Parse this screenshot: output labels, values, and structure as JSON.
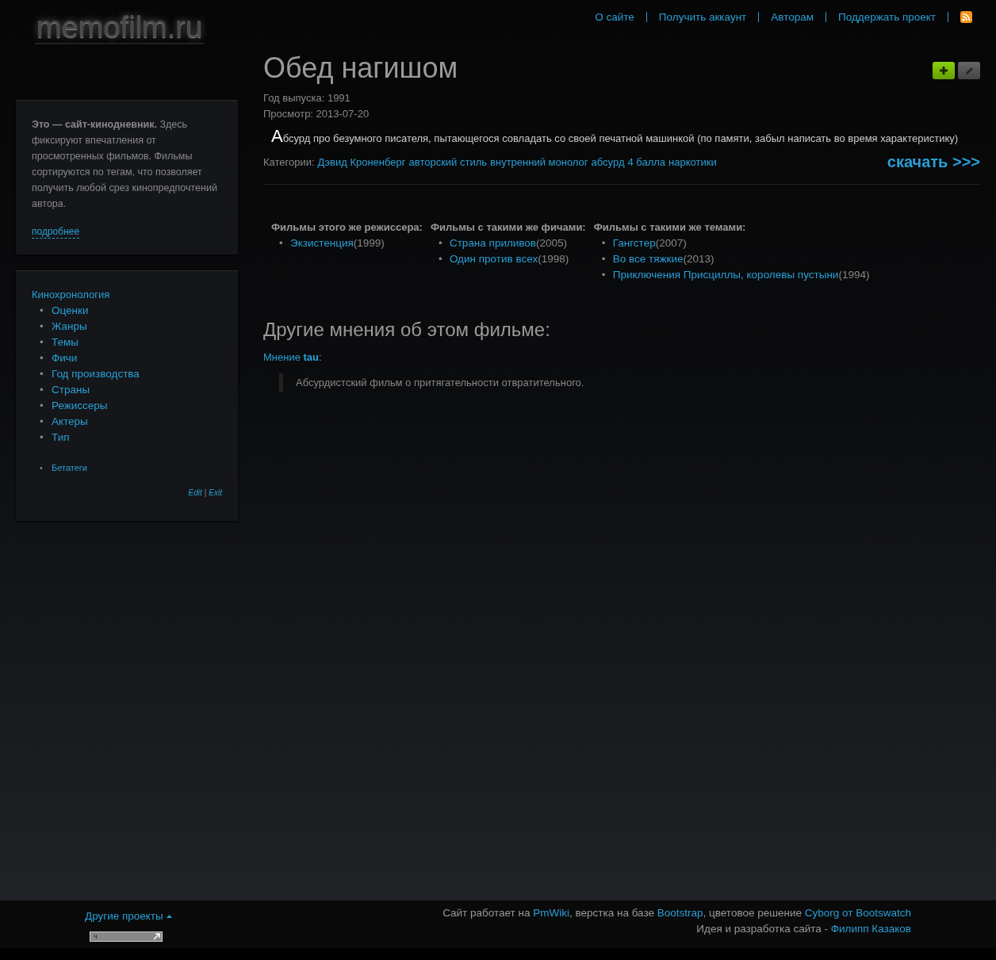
{
  "logo": "memofilm.ru",
  "top_nav": [
    {
      "label": "О сайте"
    },
    {
      "label": "Получить аккаунт"
    },
    {
      "label": "Авторам"
    },
    {
      "label": "Поддержать проект"
    }
  ],
  "about_box": {
    "text": "**Это — сайт-кинодневник.** Здесь фиксируют впечатления от просмотренных фильмов. Фильмы сортируются по тегам, что позволяет получить любой срез кинопредпочтений автора.",
    "more_link": "подробнее"
  },
  "nav_box": {
    "title": "Кинохронология",
    "items": [
      {
        "bullet": "•",
        "label": "Оценки"
      },
      {
        "bullet": "•",
        "label": "Жанры"
      },
      {
        "bullet": "•",
        "label": "Темы"
      },
      {
        "bullet": "•",
        "label": "Фичи"
      },
      {
        "bullet": "•",
        "label": "Год производства"
      },
      {
        "bullet": "•",
        "label": "Страны"
      },
      {
        "bullet": "•",
        "label": "Режиссеры"
      },
      {
        "bullet": "•",
        "label": "Актеры"
      },
      {
        "bullet": "•",
        "label": "Тип"
      }
    ],
    "extra_items": [
      {
        "bullet": "•",
        "label": "Бетатеги"
      }
    ],
    "edit_link": "Edit",
    "separator": "|",
    "exit_link": "Exit"
  },
  "film": {
    "title": "Обед нагишом",
    "year_label": "Год выпуска:",
    "year": "1991",
    "viewed_label": "Просмотр:",
    "viewed": "2013-07-20",
    "description": "Абсурд про безумного писателя, пытающегося совладать со своей печатной машинкой (по памяти, забыл написать во время характеристику)",
    "categories_label": "Категории:",
    "categories": [
      "Дэвид Кроненберг",
      "авторский стиль",
      "внутренний монолог",
      "абсурд",
      "4 балла",
      "наркотики"
    ],
    "download": "скачать >>>"
  },
  "related": [
    {
      "heading": "Фильмы этого же режиссера:",
      "items": [
        {
          "bullet": "•",
          "title": "Экзистенция",
          "year": "(1999)"
        }
      ]
    },
    {
      "heading": "Фильмы с такими же фичами:",
      "items": [
        {
          "bullet": "•",
          "title": "Страна приливов",
          "year": "(2005)"
        },
        {
          "bullet": "•",
          "title": "Один против всех",
          "year": "(1998)"
        }
      ]
    },
    {
      "heading": "Фильмы с такими же темами:",
      "items": [
        {
          "bullet": "•",
          "title": "Гангстер",
          "year": "(2007)"
        },
        {
          "bullet": "•",
          "title": "Во все тяжкие",
          "year": "(2013)"
        },
        {
          "bullet": "•",
          "title": "Приключения Присциллы, королевы пустыни",
          "year": "(1994)"
        }
      ]
    }
  ],
  "opinions": {
    "heading": "Другие мнения об этом фильме:",
    "items": [
      {
        "author_link": "Мнение **tau**",
        "colon": ":",
        "quote": "Абсурдистский фильм о притягательности отвратительного."
      }
    ]
  },
  "footer": {
    "projects": "Другие проекты",
    "counter": "ч",
    "lines": [
      [
        {
          "kind": "text",
          "text": "Сайт работает на "
        },
        {
          "kind": "link",
          "text": "PmWiki"
        },
        {
          "kind": "text",
          "text": ", верстка на базе "
        },
        {
          "kind": "link",
          "text": "Bootstrap"
        },
        {
          "kind": "text",
          "text": ", цветовое решение "
        },
        {
          "kind": "link",
          "text": "Cyborg от Bootswatch"
        }
      ],
      [
        {
          "kind": "text",
          "text": "Идея и разработка сайта - "
        },
        {
          "kind": "link",
          "text": "Филипп Казаков"
        }
      ]
    ]
  }
}
